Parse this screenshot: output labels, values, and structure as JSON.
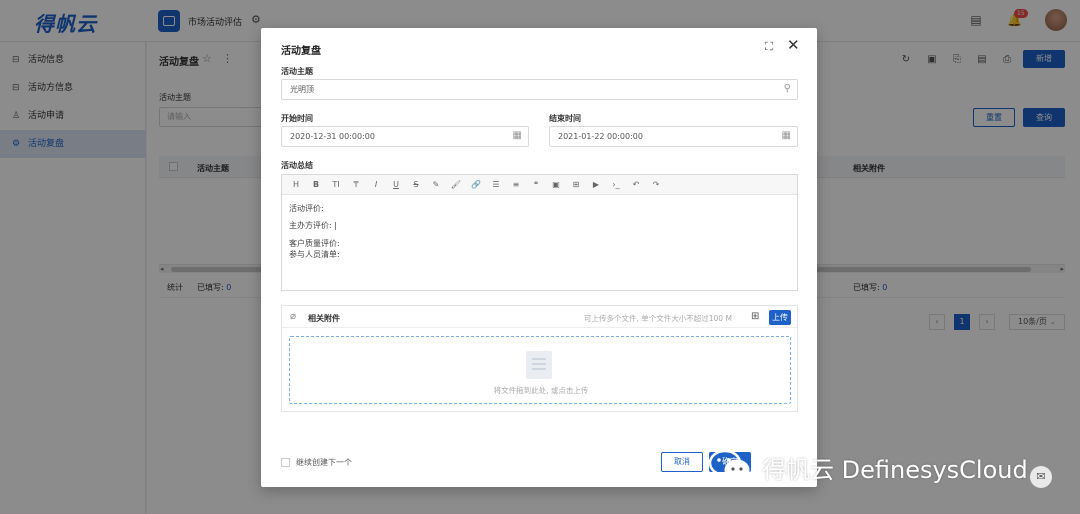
{
  "header": {
    "logo_text": "得帆云",
    "app_name": "市场活动评估",
    "notification_count": "15"
  },
  "sidebar": {
    "items": [
      {
        "label": "活动信息",
        "icon": "table-icon"
      },
      {
        "label": "活动方信息",
        "icon": "table-icon"
      },
      {
        "label": "活动申请",
        "icon": "org-icon"
      },
      {
        "label": "活动复盘",
        "icon": "gear-icon",
        "active": true
      }
    ]
  },
  "main": {
    "title": "活动复盘",
    "new_button": "新增",
    "filter_label": "活动主题",
    "filter_placeholder": "请输入",
    "reset_button": "重置",
    "query_button": "查询",
    "columns": [
      "活动主题",
      "相关附件"
    ],
    "stat_label": "统计",
    "stat_filled_1": "已填写:",
    "stat_value_1": "0",
    "stat_filled_2": "已填写:",
    "stat_value_2": "0",
    "pager": {
      "current": "1",
      "page_size": "10条/页"
    }
  },
  "modal": {
    "title": "活动复盘",
    "topic_label": "活动主题",
    "topic_value": "光明顶",
    "start_label": "开始时间",
    "start_value": "2020-12-31 00:00:00",
    "end_label": "结束时间",
    "end_value": "2021-01-22 00:00:00",
    "summary_label": "活动总结",
    "toolbar": [
      "H",
      "B",
      "TI",
      "₸",
      "I",
      "U",
      "S",
      "✎",
      "🖌",
      "🔗",
      "☰",
      "≡",
      "❝",
      "▣",
      "⊞",
      "▶",
      "›_",
      "↶",
      "↷"
    ],
    "editor_lines": [
      "活动评价:",
      "主办方评价: |",
      "客户质量评价:",
      "参与人员清单:"
    ],
    "attachment_title": "相关附件",
    "attachment_hint": "可上传多个文件, 单个文件大小不超过100 M",
    "upload_button": "上传",
    "dropzone_text": "将文件拖到此处, 或点击上传",
    "continue_label": "继续创建下一个",
    "cancel_button": "取消",
    "confirm_button": "确定"
  },
  "watermark": {
    "text": "得帆云 DefinesysCloud"
  },
  "colors": {
    "primary": "#1e62c8",
    "sidebar_active_bg": "#dde6f4",
    "badge": "#f04a4a"
  }
}
